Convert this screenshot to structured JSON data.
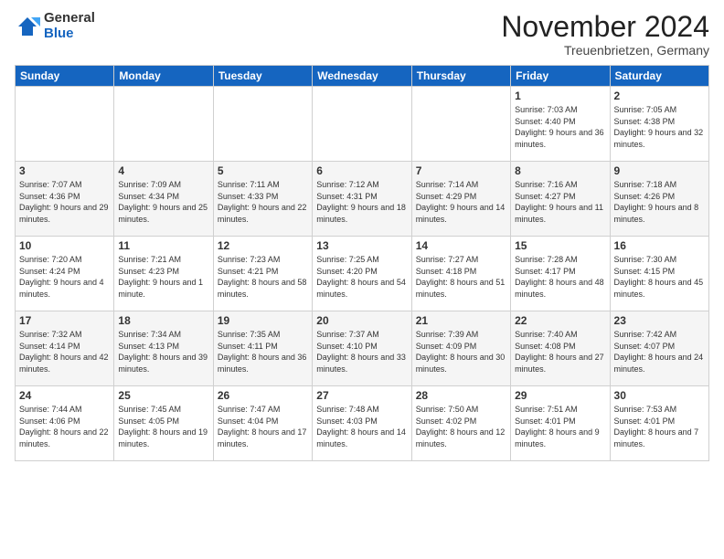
{
  "logo": {
    "general": "General",
    "blue": "Blue"
  },
  "header": {
    "month_title": "November 2024",
    "location": "Treuenbrietzen, Germany"
  },
  "weekdays": [
    "Sunday",
    "Monday",
    "Tuesday",
    "Wednesday",
    "Thursday",
    "Friday",
    "Saturday"
  ],
  "weeks": [
    [
      {
        "day": "",
        "info": ""
      },
      {
        "day": "",
        "info": ""
      },
      {
        "day": "",
        "info": ""
      },
      {
        "day": "",
        "info": ""
      },
      {
        "day": "",
        "info": ""
      },
      {
        "day": "1",
        "info": "Sunrise: 7:03 AM\nSunset: 4:40 PM\nDaylight: 9 hours and 36 minutes."
      },
      {
        "day": "2",
        "info": "Sunrise: 7:05 AM\nSunset: 4:38 PM\nDaylight: 9 hours and 32 minutes."
      }
    ],
    [
      {
        "day": "3",
        "info": "Sunrise: 7:07 AM\nSunset: 4:36 PM\nDaylight: 9 hours and 29 minutes."
      },
      {
        "day": "4",
        "info": "Sunrise: 7:09 AM\nSunset: 4:34 PM\nDaylight: 9 hours and 25 minutes."
      },
      {
        "day": "5",
        "info": "Sunrise: 7:11 AM\nSunset: 4:33 PM\nDaylight: 9 hours and 22 minutes."
      },
      {
        "day": "6",
        "info": "Sunrise: 7:12 AM\nSunset: 4:31 PM\nDaylight: 9 hours and 18 minutes."
      },
      {
        "day": "7",
        "info": "Sunrise: 7:14 AM\nSunset: 4:29 PM\nDaylight: 9 hours and 14 minutes."
      },
      {
        "day": "8",
        "info": "Sunrise: 7:16 AM\nSunset: 4:27 PM\nDaylight: 9 hours and 11 minutes."
      },
      {
        "day": "9",
        "info": "Sunrise: 7:18 AM\nSunset: 4:26 PM\nDaylight: 9 hours and 8 minutes."
      }
    ],
    [
      {
        "day": "10",
        "info": "Sunrise: 7:20 AM\nSunset: 4:24 PM\nDaylight: 9 hours and 4 minutes."
      },
      {
        "day": "11",
        "info": "Sunrise: 7:21 AM\nSunset: 4:23 PM\nDaylight: 9 hours and 1 minute."
      },
      {
        "day": "12",
        "info": "Sunrise: 7:23 AM\nSunset: 4:21 PM\nDaylight: 8 hours and 58 minutes."
      },
      {
        "day": "13",
        "info": "Sunrise: 7:25 AM\nSunset: 4:20 PM\nDaylight: 8 hours and 54 minutes."
      },
      {
        "day": "14",
        "info": "Sunrise: 7:27 AM\nSunset: 4:18 PM\nDaylight: 8 hours and 51 minutes."
      },
      {
        "day": "15",
        "info": "Sunrise: 7:28 AM\nSunset: 4:17 PM\nDaylight: 8 hours and 48 minutes."
      },
      {
        "day": "16",
        "info": "Sunrise: 7:30 AM\nSunset: 4:15 PM\nDaylight: 8 hours and 45 minutes."
      }
    ],
    [
      {
        "day": "17",
        "info": "Sunrise: 7:32 AM\nSunset: 4:14 PM\nDaylight: 8 hours and 42 minutes."
      },
      {
        "day": "18",
        "info": "Sunrise: 7:34 AM\nSunset: 4:13 PM\nDaylight: 8 hours and 39 minutes."
      },
      {
        "day": "19",
        "info": "Sunrise: 7:35 AM\nSunset: 4:11 PM\nDaylight: 8 hours and 36 minutes."
      },
      {
        "day": "20",
        "info": "Sunrise: 7:37 AM\nSunset: 4:10 PM\nDaylight: 8 hours and 33 minutes."
      },
      {
        "day": "21",
        "info": "Sunrise: 7:39 AM\nSunset: 4:09 PM\nDaylight: 8 hours and 30 minutes."
      },
      {
        "day": "22",
        "info": "Sunrise: 7:40 AM\nSunset: 4:08 PM\nDaylight: 8 hours and 27 minutes."
      },
      {
        "day": "23",
        "info": "Sunrise: 7:42 AM\nSunset: 4:07 PM\nDaylight: 8 hours and 24 minutes."
      }
    ],
    [
      {
        "day": "24",
        "info": "Sunrise: 7:44 AM\nSunset: 4:06 PM\nDaylight: 8 hours and 22 minutes."
      },
      {
        "day": "25",
        "info": "Sunrise: 7:45 AM\nSunset: 4:05 PM\nDaylight: 8 hours and 19 minutes."
      },
      {
        "day": "26",
        "info": "Sunrise: 7:47 AM\nSunset: 4:04 PM\nDaylight: 8 hours and 17 minutes."
      },
      {
        "day": "27",
        "info": "Sunrise: 7:48 AM\nSunset: 4:03 PM\nDaylight: 8 hours and 14 minutes."
      },
      {
        "day": "28",
        "info": "Sunrise: 7:50 AM\nSunset: 4:02 PM\nDaylight: 8 hours and 12 minutes."
      },
      {
        "day": "29",
        "info": "Sunrise: 7:51 AM\nSunset: 4:01 PM\nDaylight: 8 hours and 9 minutes."
      },
      {
        "day": "30",
        "info": "Sunrise: 7:53 AM\nSunset: 4:01 PM\nDaylight: 8 hours and 7 minutes."
      }
    ]
  ]
}
